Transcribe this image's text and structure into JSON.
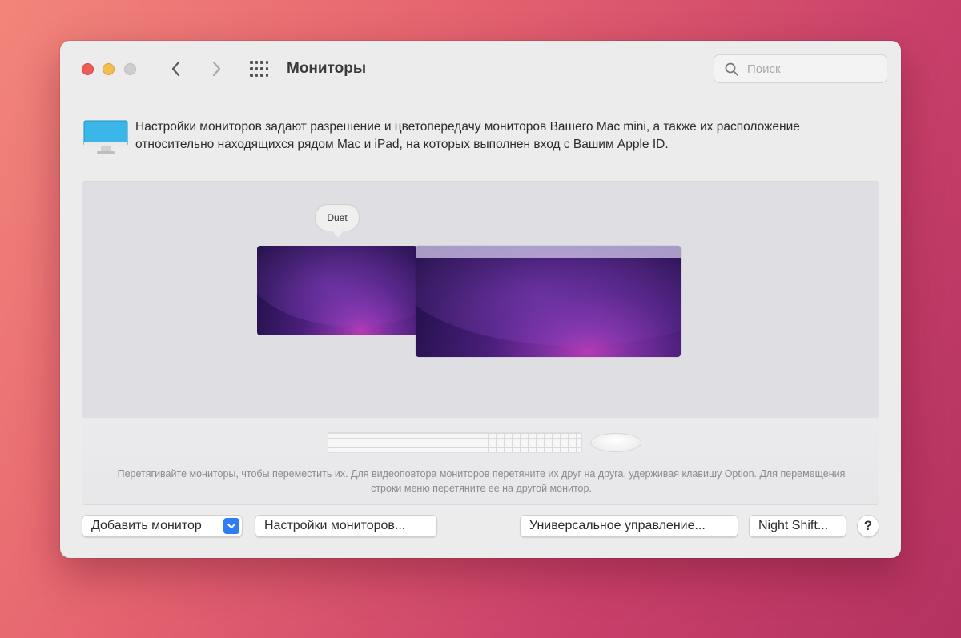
{
  "window": {
    "title": "Мониторы",
    "search": {
      "placeholder": "Поиск",
      "icon": "search-icon"
    }
  },
  "toolbar": {
    "back_icon": "chevron-left-icon",
    "forward_icon": "chevron-right-icon",
    "grid_icon": "grid-icon"
  },
  "header": {
    "icon": "monitor-icon",
    "description": "Настройки мониторов задают разрешение и цветопередачу мониторов Вашего Mac mini, а также их расположение относительно находящихся рядом Mac и iPad, на которых выполнен вход с Вашим Apple ID."
  },
  "arrangement": {
    "displays": [
      {
        "name": "Duet",
        "has_menu_bar": false
      },
      {
        "name": "",
        "has_menu_bar": true
      }
    ],
    "tooltip": "Duet",
    "hint": "Перетягивайте мониторы, чтобы переместить их. Для видеоповтора мониторов перетяните их друг на друга, удерживая клавишу Option. Для перемещения строки меню перетяните ее на другой монитор."
  },
  "buttons": {
    "add_monitor": "Добавить монитор",
    "display_settings": "Настройки мониторов...",
    "universal_control": "Универсальное управление...",
    "night_shift": "Night Shift...",
    "help": "?"
  },
  "colors": {
    "accent": "#2f7cf6",
    "close": "#ee5c57",
    "minimize": "#f4bd4f",
    "zoom_disabled": "#cdcdcd"
  }
}
